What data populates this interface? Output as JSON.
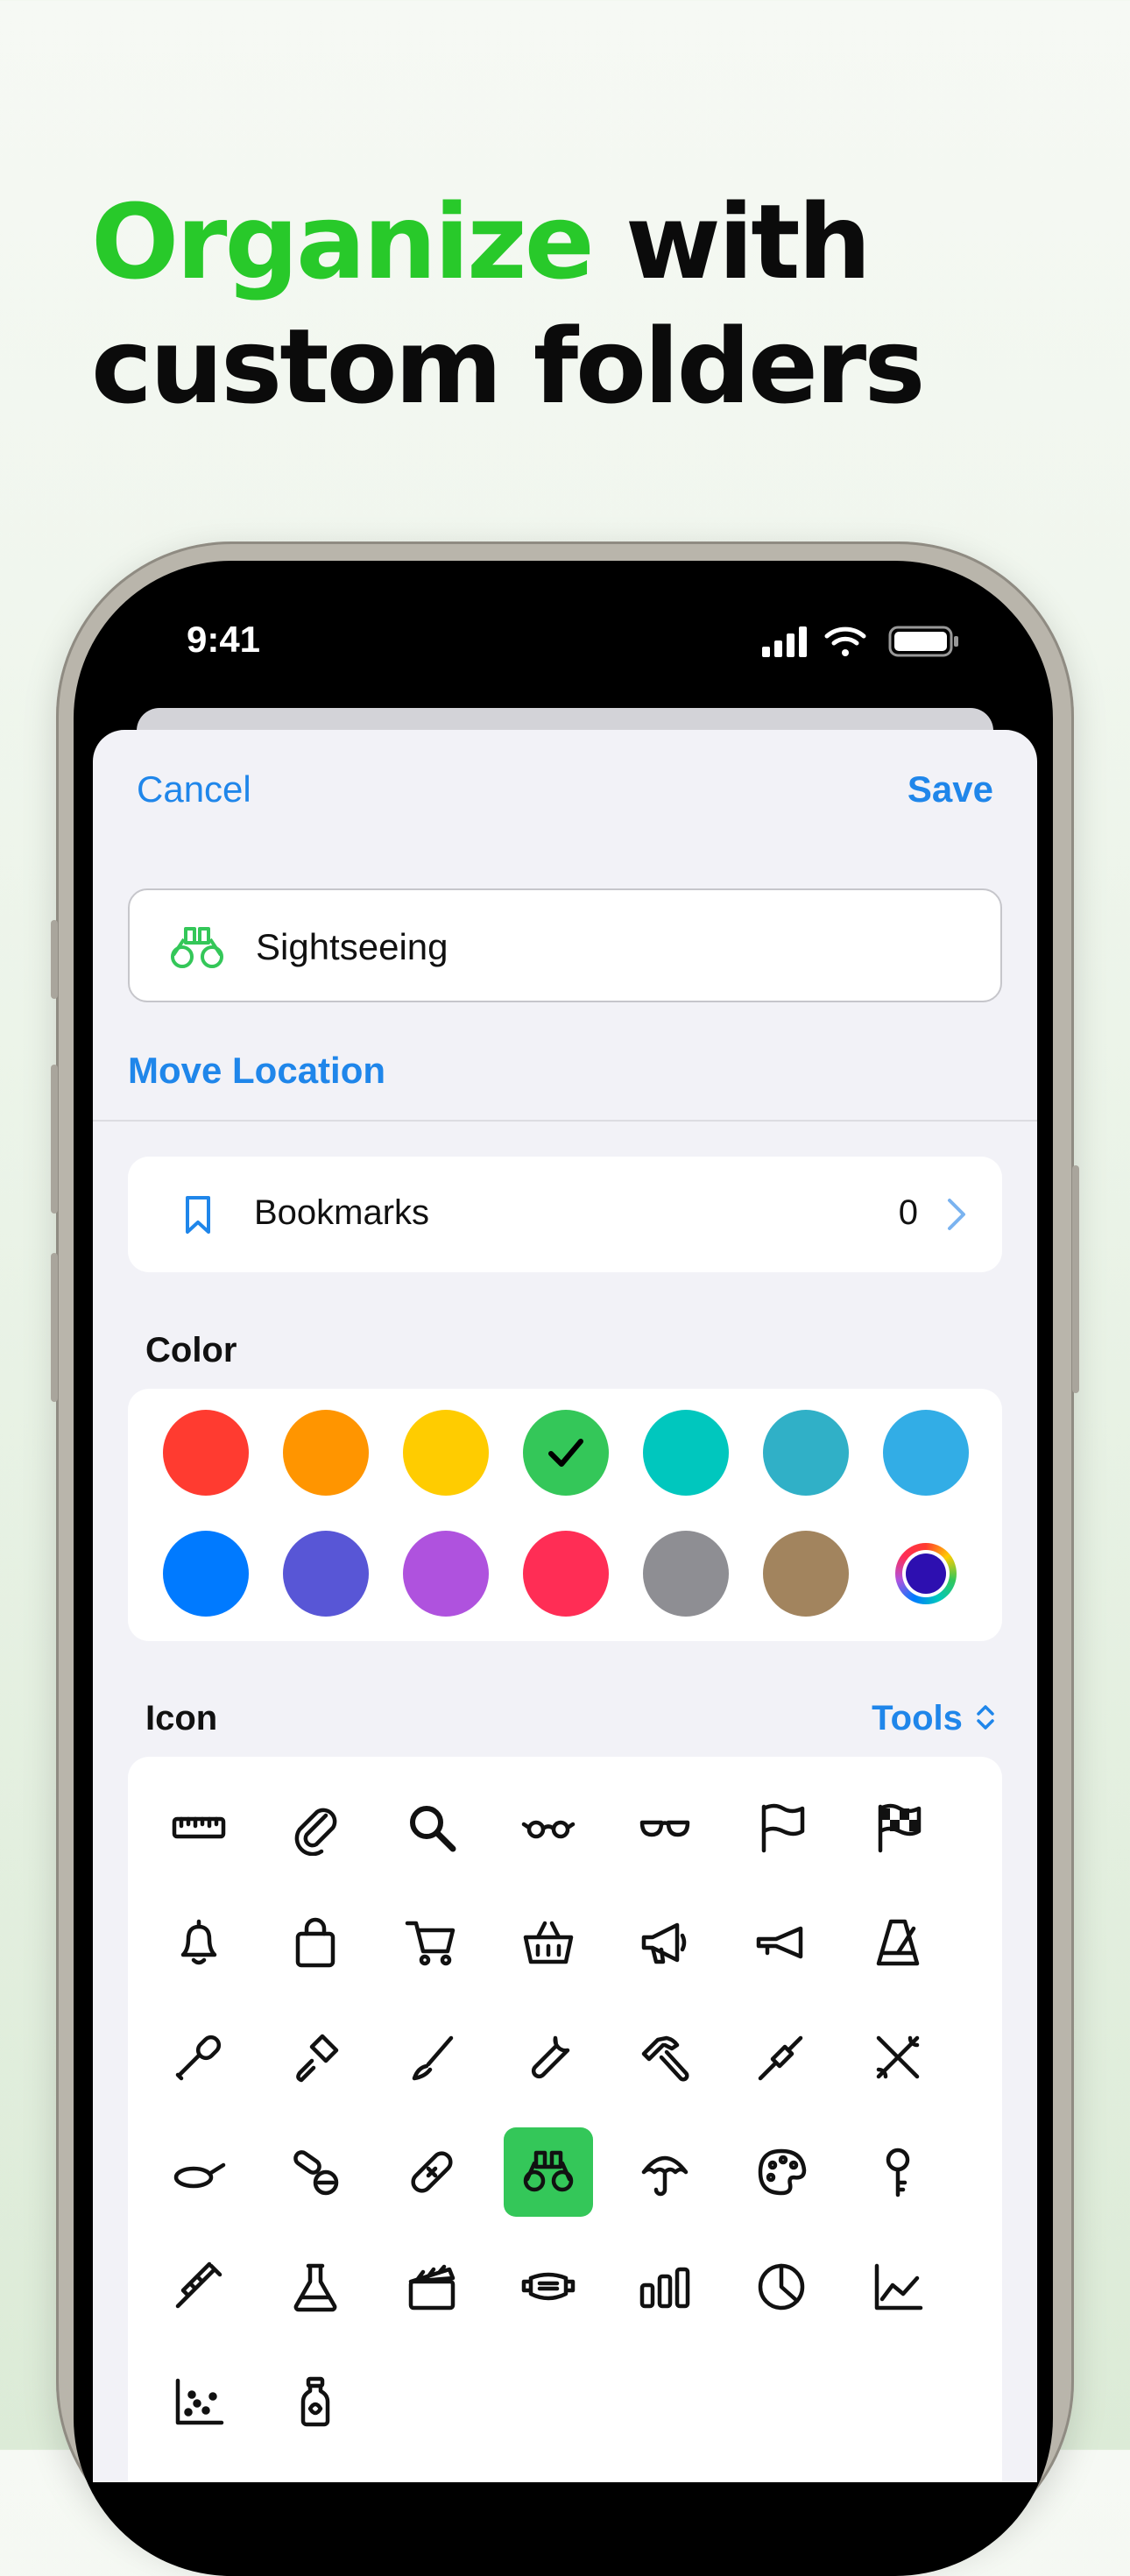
{
  "headline": {
    "accent": "Organize",
    "rest_line1": " with",
    "line2": "custom folders"
  },
  "colors": {
    "accent_green": "#28c92a",
    "link_blue": "#1f86ea",
    "selected_icon_bg": "#34c759"
  },
  "status_bar": {
    "time": "9:41"
  },
  "nav": {
    "cancel": "Cancel",
    "save": "Save"
  },
  "folder": {
    "name": "Sightseeing",
    "icon": "binoculars-icon"
  },
  "move_location": "Move Location",
  "bookmarks": {
    "label": "Bookmarks",
    "count": "0"
  },
  "color_section": {
    "label": "Color",
    "swatches": [
      "#ff3b30",
      "#ff9500",
      "#ffcc00",
      "#34c759",
      "#00c7be",
      "#30b0c7",
      "#32ade6",
      "#007aff",
      "#5856d6",
      "#af52de",
      "#ff2d55",
      "#8e8e93",
      "#a2845e",
      "color-picker"
    ],
    "selected_index": 3
  },
  "icon_section": {
    "label": "Icon",
    "category": "Tools",
    "icons": [
      "ruler-icon",
      "paperclip-icon",
      "magnifying-glass-icon",
      "eyeglasses-icon",
      "sunglasses-icon",
      "flag-icon",
      "checkered-flag-icon",
      "bell-icon",
      "shopping-bag-icon",
      "cart-icon",
      "basket-icon",
      "megaphone-icon",
      "horn-icon",
      "metronome-icon",
      "microphone-icon",
      "paintbrush-icon",
      "brush-icon",
      "wrench-icon",
      "hammer-icon",
      "screwdriver-icon",
      "wrench-and-screwdriver-icon",
      "frying-pan-icon",
      "pills-icon",
      "bandage-icon",
      "binoculars-icon",
      "umbrella-icon",
      "palette-icon",
      "key-icon",
      "syringe-icon",
      "flask-icon",
      "clapperboard-icon",
      "face-mask-icon",
      "bar-chart-icon",
      "pie-chart-icon",
      "line-chart-icon",
      "scatter-chart-icon",
      "bottle-icon"
    ],
    "selected_index": 24
  }
}
